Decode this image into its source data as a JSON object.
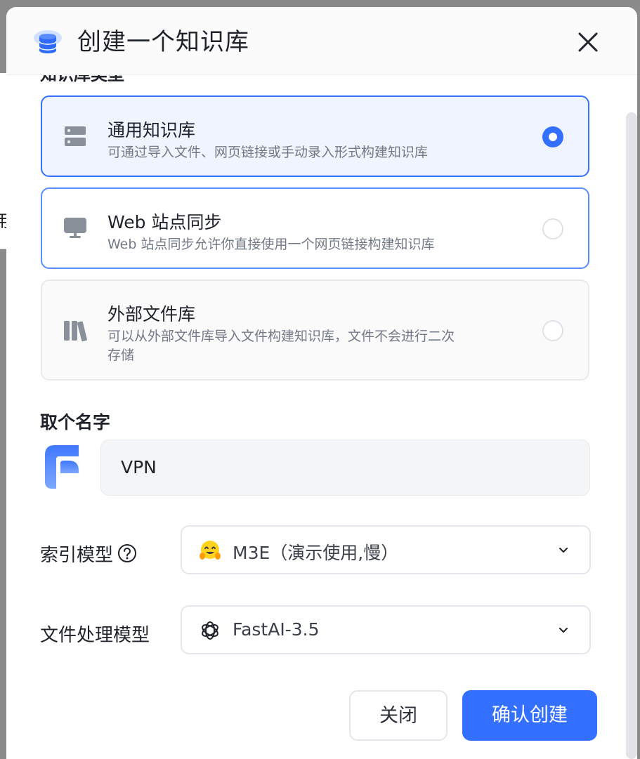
{
  "background": {
    "left_partial_text": "用"
  },
  "modal": {
    "title": "创建一个知识库",
    "title_icon": "database-icon",
    "close_icon": "close-icon"
  },
  "type_section": {
    "label": "知识库类型",
    "options": [
      {
        "title": "通用知识库",
        "desc": "可通过导入文件、网页链接或手动录入形式构建知识库",
        "icon": "server-icon",
        "selected": true
      },
      {
        "title": "Web 站点同步",
        "desc": "Web 站点同步允许你直接使用一个网页链接构建知识库",
        "icon": "monitor-icon",
        "selected": false
      },
      {
        "title": "外部文件库",
        "desc_line1": "可以从外部文件库导入文件构建知识库，文件不会进行二次",
        "desc_line2": "存储",
        "icon": "library-icon",
        "selected": false
      }
    ]
  },
  "name_section": {
    "label": "取个名字",
    "value": "VPN",
    "avatar_icon": "app-logo-icon"
  },
  "index_model": {
    "label": "索引模型",
    "value": "M3E（演示使用,慢）",
    "icon": "hugging-face-icon"
  },
  "file_model": {
    "label": "文件处理模型",
    "value": "FastAI-3.5",
    "icon": "openai-icon"
  },
  "buttons": {
    "close": "关闭",
    "confirm": "确认创建"
  },
  "colors": {
    "primary": "#3370ff",
    "selected_bg": "#f0f4ff"
  }
}
